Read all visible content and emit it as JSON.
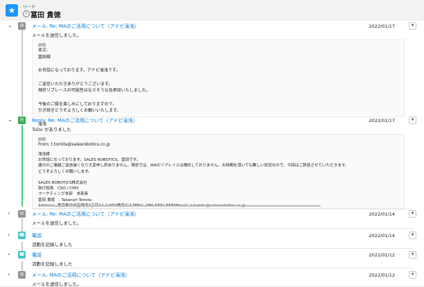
{
  "header": {
    "object_label": "リード",
    "record_name": "冨田 貴徳"
  },
  "items": [
    {
      "type": "email",
      "expanded": true,
      "title": "メール: Re: MAのご活用について（アドビ滝浅）",
      "date": "2022/01/17",
      "subtitle": "メールを送信しました。",
      "detail_label": "説明",
      "detail_text": "本文:\n冨田様\n\nお世話になっております。アドビ滝浅です。\n\nご返信いただきありがとうございます。\n現状リプレースの可能性はなさそうな旨承知いたしました。\n\n今後のご縁を楽しみにしておりますので、\n引き続きどうぞよろしくお願いいたします。\n\n滝浅"
    },
    {
      "type": "task",
      "expanded": true,
      "title": "Reply: Re: MAのご活用について（アドビ滝浅）",
      "date": "2022/01/17",
      "subtitle": "ToDo がありました",
      "detail_label": "説明",
      "detail_from": "From: t.tomita@salesrobotics.co.jp",
      "detail_text": "滝浅様\nお世話になっております。SALES ROBOTICS、冨田です。\n連日のご連絡ご返信遅くなり大変申し訳ありません。現状では、MAのリプレイスは検討しておりません。お時間を頂いても難しい状況なので、今回はご辞退させていただきます。\nどうぞよろしくお願いします。\n\nSALES ROBOTICS株式会社\n執行役員　CSO / CMO\nマーケティング本部　本部長\n冨田 貴徳　- Takanori Tomita\nAddress：東京都中央区晴海3丁目12-1 KDX晴海ビル7FTel：080-5831-5589Email：t.tomita@salesrobotics.co.jp"
    },
    {
      "type": "email",
      "expanded": false,
      "title": "メール: Re: MAのご活用について（アドビ滝浅）",
      "date": "2022/01/14",
      "subtitle": "メールを送信しました。"
    },
    {
      "type": "call",
      "expanded": false,
      "title": "電話",
      "date": "2022/01/14",
      "subtitle": "活動を記録しました"
    },
    {
      "type": "call",
      "expanded": false,
      "title": "電話",
      "date": "2022/01/12",
      "subtitle": "活動を記録しました"
    },
    {
      "type": "email",
      "expanded": false,
      "title": "メール: MAのご活用について（アドビ滝浅）",
      "date": "2022/01/12",
      "subtitle": "メールを送信しました。"
    }
  ],
  "icons": {
    "lead": "star-icon",
    "email": "envelope-icon",
    "task": "list-icon",
    "call": "phone-icon",
    "expanded_chevron": "chevron-down-icon",
    "collapsed_chevron": "chevron-right-icon",
    "menu": "dropdown-icon"
  },
  "colors": {
    "accent": "#1b96ff",
    "link": "#0176d3",
    "email": "#939393",
    "task": "#3ba755",
    "call": "#48c3cc"
  }
}
